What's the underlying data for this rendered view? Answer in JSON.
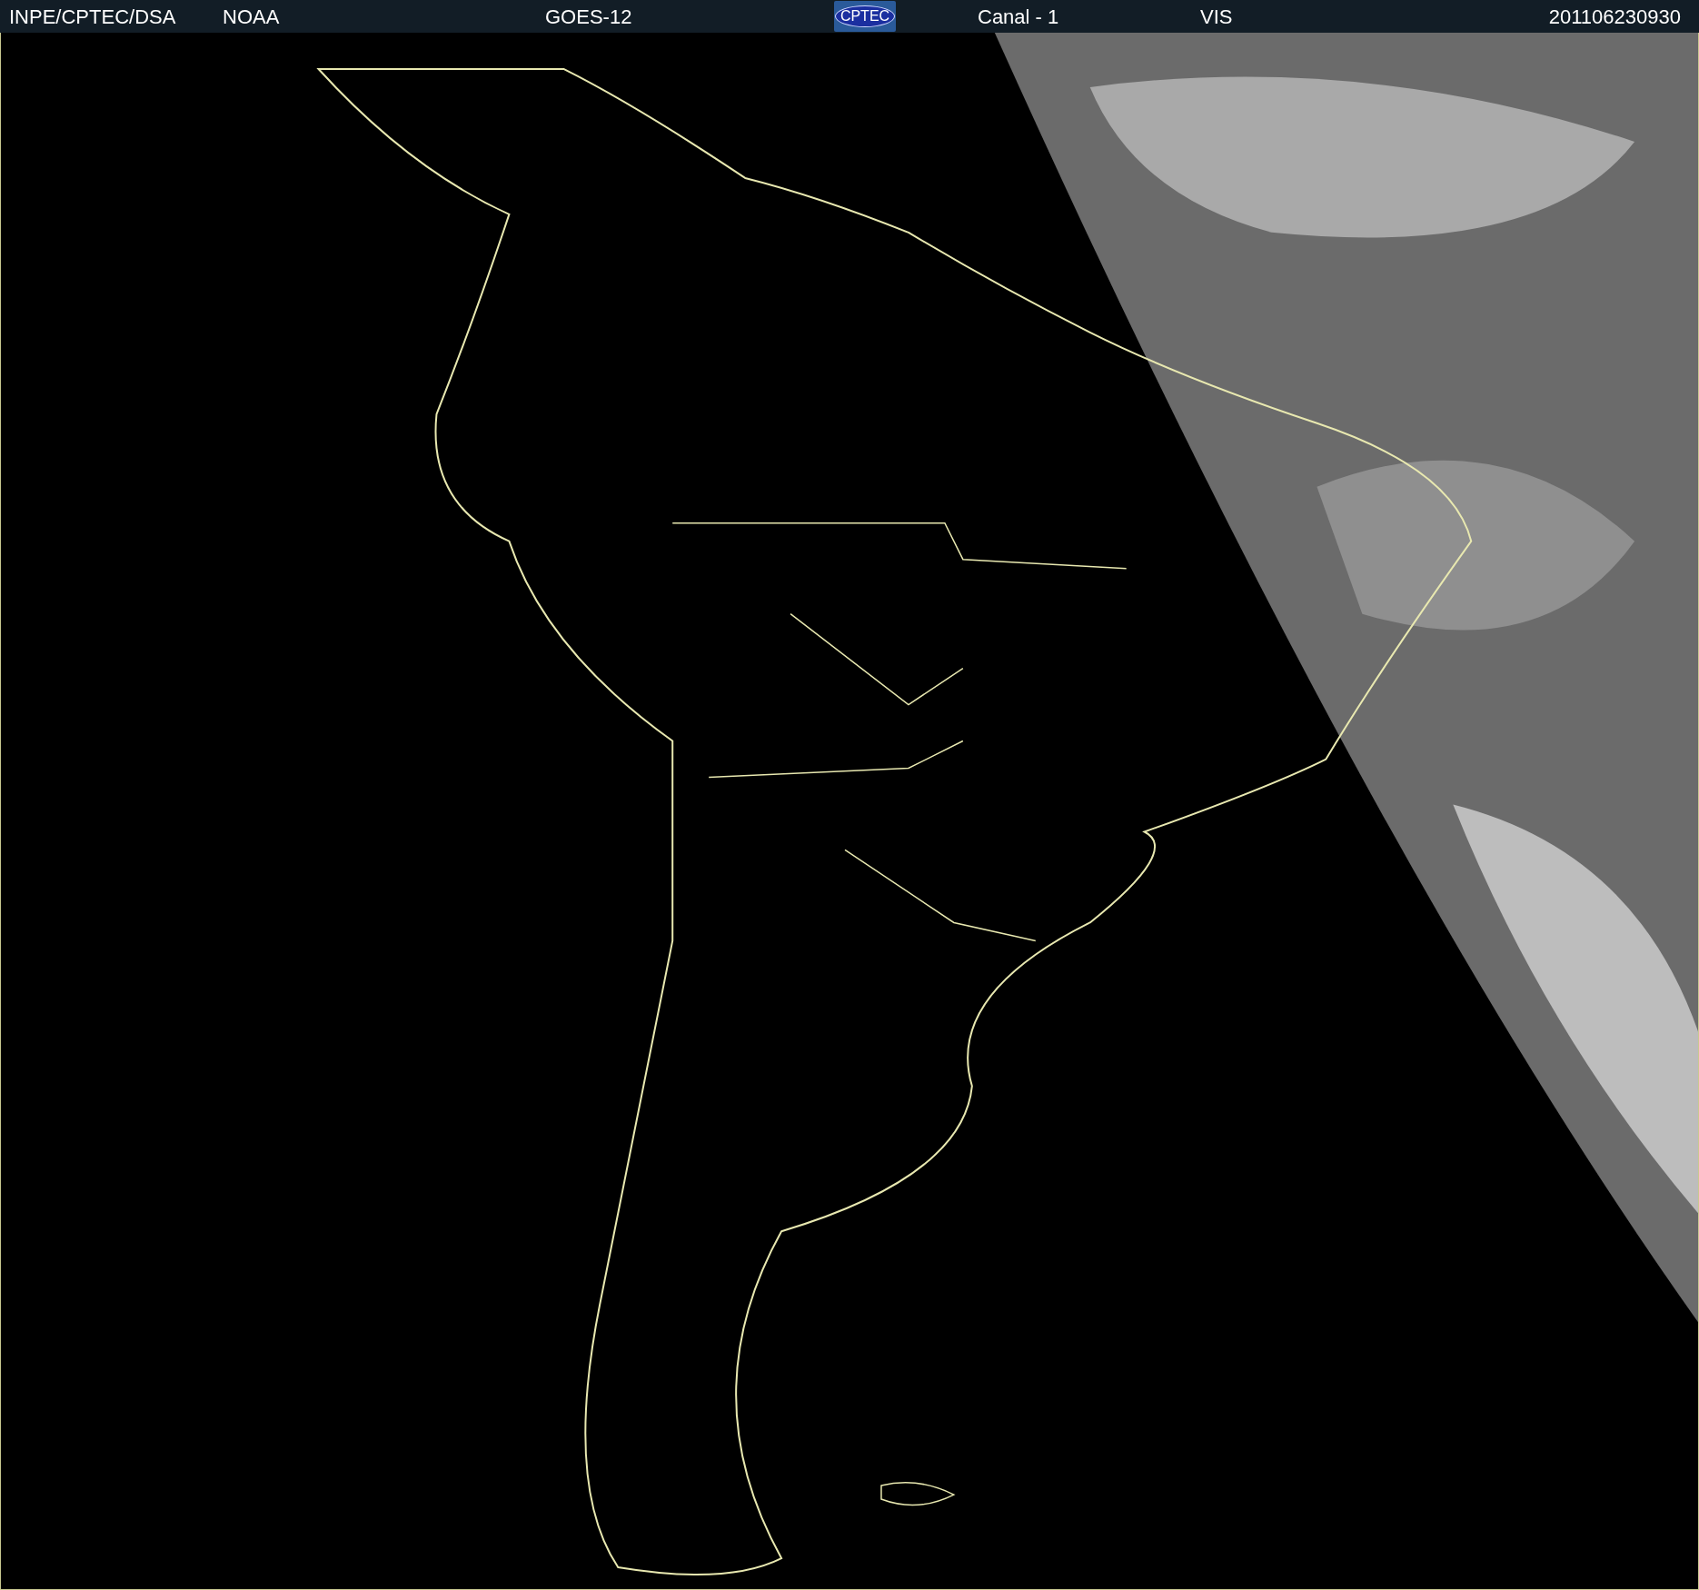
{
  "header": {
    "items": [
      {
        "kind": "text",
        "text": "INPE/CPTEC/DSA"
      },
      {
        "kind": "text",
        "text": "NOAA"
      },
      {
        "kind": "text",
        "text": "GOES-12"
      },
      {
        "kind": "logo",
        "text": "CPTEC"
      },
      {
        "kind": "text",
        "text": "Canal - 1"
      },
      {
        "kind": "text",
        "text": "VIS"
      },
      {
        "kind": "text",
        "text": "201106230930"
      }
    ]
  }
}
